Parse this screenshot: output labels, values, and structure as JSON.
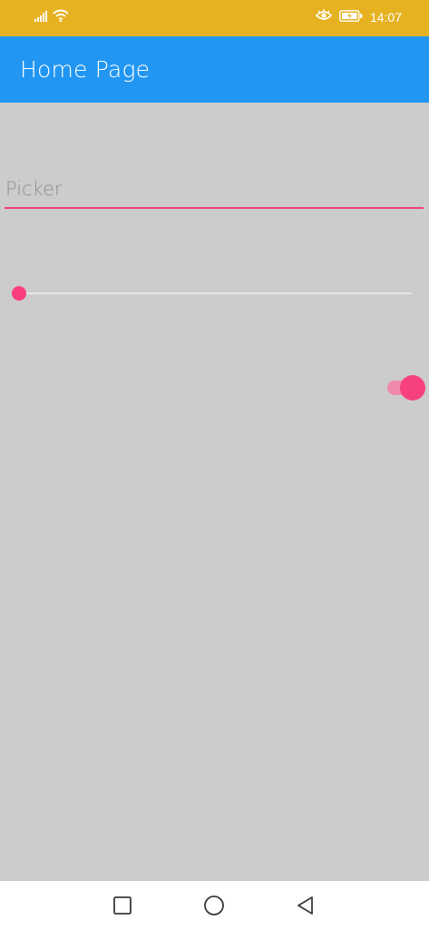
{
  "status_bar": {
    "time": "14:07",
    "icons": [
      "signal-icon",
      "wifi-icon",
      "eye-comfort-icon",
      "battery-charging-icon"
    ],
    "background": "#e6b222"
  },
  "app_bar": {
    "title": "Home Page",
    "background": "#2196f3"
  },
  "form": {
    "picker": {
      "placeholder": "Picker",
      "selected_value": ""
    },
    "slider": {
      "value_fraction": 0.0
    },
    "switch": {
      "on": true
    }
  },
  "accent_color": "#fa3f7c",
  "nav_bar": {
    "buttons": [
      "recent-apps-icon",
      "home-icon",
      "back-icon"
    ]
  }
}
